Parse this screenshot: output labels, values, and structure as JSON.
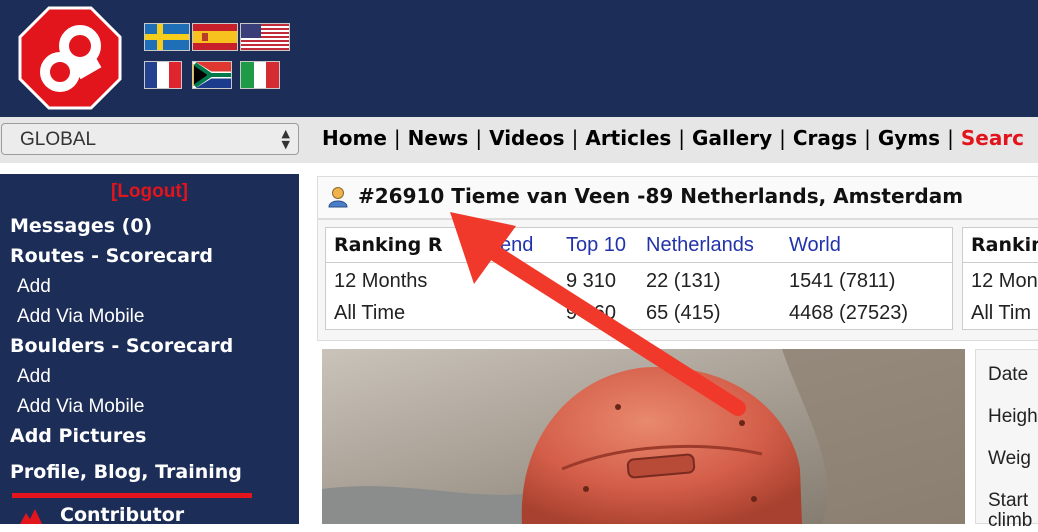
{
  "header": {
    "logo_icon": "8a-logo-icon",
    "flags": [
      "Sweden",
      "Spain",
      "United States",
      "France",
      "South Africa",
      "Italy"
    ]
  },
  "region_select": {
    "value": "GLOBAL"
  },
  "nav": {
    "items": [
      "Home",
      "News",
      "Videos",
      "Articles",
      "Gallery",
      "Crags",
      "Gyms"
    ],
    "search_label": "Searc",
    "separator": "|"
  },
  "sidebar": {
    "logout": "[Logout]",
    "messages": "Messages (0)",
    "routes": "Routes - Scorecard",
    "routes_add": "Add",
    "routes_add_mobile": "Add Via Mobile",
    "boulders": "Boulders - Scorecard",
    "boulders_add": "Add",
    "boulders_add_mobile": "Add Via Mobile",
    "add_pictures": "Add Pictures",
    "profile": "Profile, Blog, Training",
    "contributor": "Contributor"
  },
  "profile": {
    "title": "#26910 Tieme van Veen -89 Netherlands, Amsterdam",
    "user_icon": "user-icon"
  },
  "ranking": {
    "title": "Ranking R",
    "col_friend": "end",
    "col_top10": "Top 10",
    "col_country": "Netherlands",
    "col_world": "World",
    "rows": [
      {
        "label": "12 Months",
        "top10": "9 310",
        "country": "22 (131)",
        "world": "1541 (7811)"
      },
      {
        "label": "All Time",
        "top10": "9 160",
        "country": "65 (415)",
        "world": "4468 (27523)"
      }
    ]
  },
  "ranking2": {
    "title": "Rankin",
    "row1": "12 Mon",
    "row2": "All Tim"
  },
  "info": {
    "date": "Date",
    "height": "Heigh",
    "weight": "Weig",
    "started": "Start",
    "climbing": "climb"
  },
  "colors": {
    "navy": "#1c2d57",
    "red": "#e2141c",
    "link_blue": "#2233aa"
  },
  "annotation": {
    "arrow_icon": "red-arrow-icon"
  }
}
